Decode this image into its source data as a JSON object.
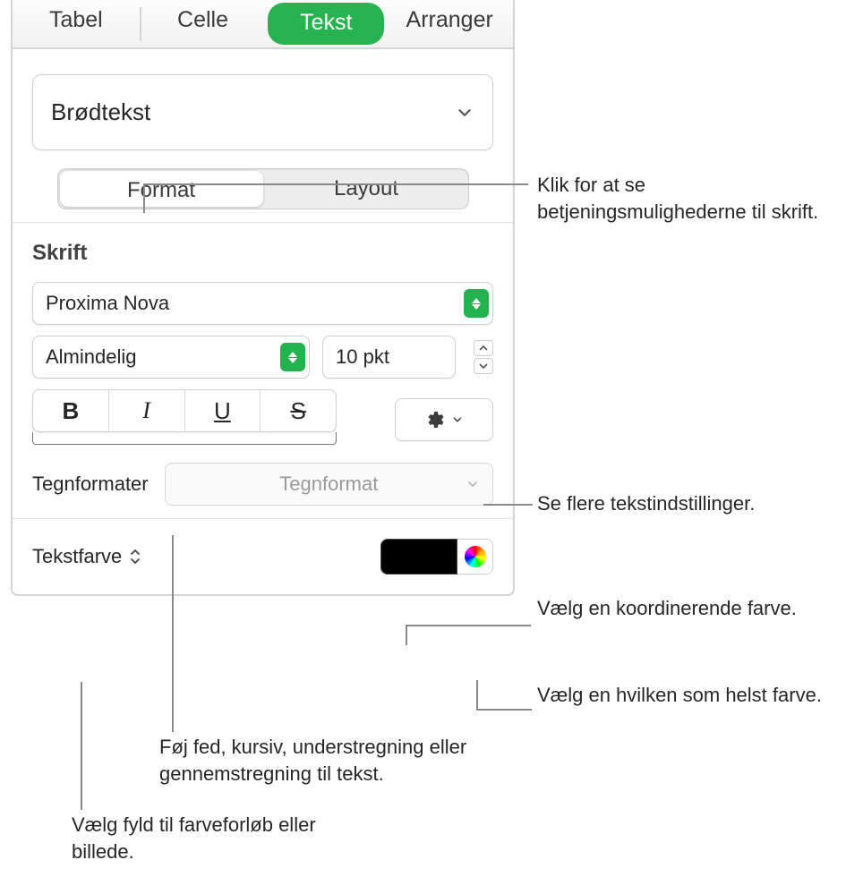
{
  "tabs": {
    "t0": "Tabel",
    "t1": "Celle",
    "t2": "Tekst",
    "t3": "Arranger"
  },
  "style_name": "Brødtekst",
  "seg": {
    "format": "Format",
    "layout": "Layout"
  },
  "skrift_label": "Skrift",
  "font_name": "Proxima Nova",
  "font_style": "Almindelig",
  "font_size": "10 pkt",
  "charfmt_label": "Tegnformater",
  "charfmt_placeholder": "Tegnformat",
  "textcolor_label": "Tekstfarve",
  "callouts": {
    "format": "Klik for at se betjeningsmulighederne til skrift.",
    "gear": "Se flere tekstindstillinger.",
    "wellblack": "Vælg en koordinerende farve.",
    "wellpicker": "Vælg en hvilken som helst farve.",
    "bius": "Føj fed, kursiv, understregning eller gennemstregning til tekst.",
    "textcolor": "Vælg fyld til farveforløb eller billede."
  }
}
